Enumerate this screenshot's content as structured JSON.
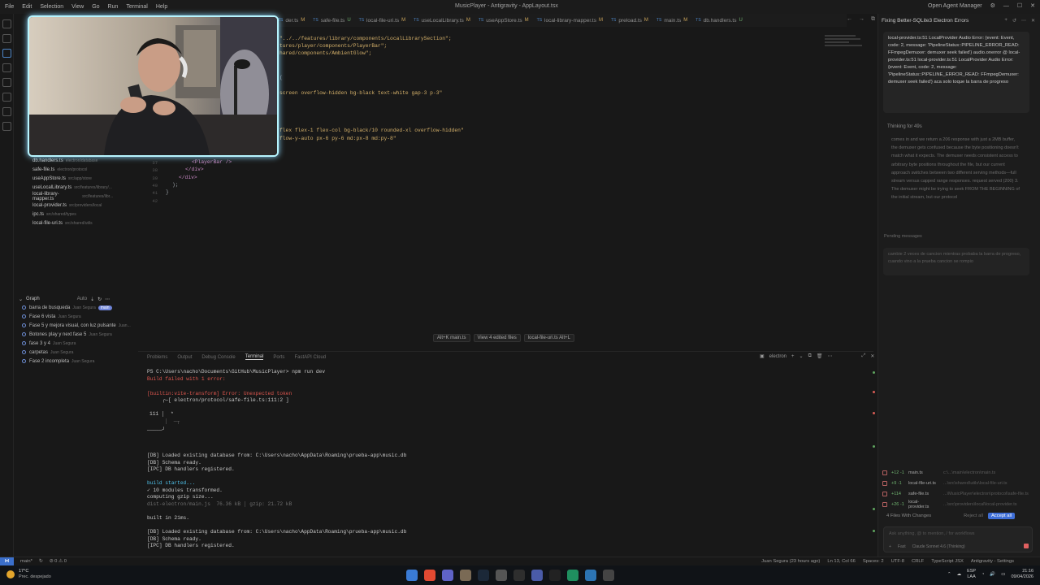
{
  "titlebar": {
    "menu": [
      "File",
      "Edit",
      "Selection",
      "View",
      "Go",
      "Run",
      "Terminal",
      "Help"
    ],
    "title": "MusicPlayer - Antigravity - AppLayout.tsx",
    "agent_manager": "Open Agent Manager"
  },
  "tabs": [
    {
      "label": "der.ts",
      "mark": "M",
      "icon": "ts"
    },
    {
      "label": "safe-file.ts",
      "mark": "U",
      "icon": "ts"
    },
    {
      "label": "local-file-uri.ts",
      "mark": "M",
      "icon": "ts"
    },
    {
      "label": "useLocalLibrary.ts",
      "mark": "M",
      "icon": "ts"
    },
    {
      "label": "useAppStore.ts",
      "mark": "M",
      "icon": "ts"
    },
    {
      "label": "local-library-mapper.ts",
      "mark": "M",
      "icon": "ts"
    },
    {
      "label": "preload.ts",
      "mark": "M",
      "icon": "ts"
    },
    {
      "label": "main.ts",
      "mark": "M",
      "icon": "ts"
    },
    {
      "label": "db.handlers.ts",
      "mark": "U",
      "icon": "ts"
    }
  ],
  "sidebar": {
    "files": [
      {
        "name": "db.handlers.ts",
        "path": "electron/database",
        "status": "U"
      },
      {
        "name": "safe-file.ts",
        "path": "electron/protocol",
        "status": "U"
      },
      {
        "name": "useAppStore.ts",
        "path": "src/app/store",
        "status": "M"
      },
      {
        "name": "useLocalLibrary.ts",
        "path": "src/features/library/...",
        "status": "M"
      },
      {
        "name": "local-library-mapper.ts",
        "path": "src/features/libr...",
        "status": "M"
      },
      {
        "name": "local-provider.ts",
        "path": "src/providers/local",
        "status": "M"
      },
      {
        "name": "ipc.ts",
        "path": "src/shared/types",
        "status": "U"
      },
      {
        "name": "local-file-uri.ts",
        "path": "src/shared/utils",
        "status": "M"
      }
    ],
    "graph": {
      "title": "Graph",
      "auto": "Auto",
      "commits": [
        {
          "message": "barra de busqueda",
          "author": "Juan Segura",
          "badge": "main"
        },
        {
          "message": "Fase 6 vista",
          "author": "Juan Segura"
        },
        {
          "message": "Fase 5 y mejora visual, con luz pulsante",
          "author": "Juan..."
        },
        {
          "message": "Botones play y next fase 5",
          "author": "Juan Segura"
        },
        {
          "message": "fase 3 y 4",
          "author": "Juan Segura"
        },
        {
          "message": "carpetas",
          "author": "Juan Segura"
        },
        {
          "message": "Fase 2 incompleta",
          "author": "Juan Segura"
        }
      ]
    }
  },
  "editor": {
    "lines": [
      {
        "text": "\"../../features/library/components/LocalLibrarySection\";",
        "kind": "s"
      },
      {
        "text": "tures/player/components/PlayerBar\";",
        "kind": "s"
      },
      {
        "text": "hared/components/AmbientGlow\";",
        "kind": "s"
      },
      {
        "text": "(",
        "kind": "g"
      },
      {
        "text": "screen overflow-hidden bg-black text-white gap-3 p-3\"",
        "kind": "s"
      },
      {
        "text": "flex flex-1 flex-col bg-black/10 rounded-xl overflow-hidden\"",
        "kind": "s"
      },
      {
        "text": "flow-y-auto px-6 py-6 md:px-8 md:py-8\"",
        "kind": "s"
      },
      {
        "text": "<PlayerBar />",
        "kind": "j"
      },
      {
        "text": "</div>",
        "kind": "j"
      },
      {
        "text": "</div>",
        "kind": "j"
      },
      {
        "text": ");",
        "kind": "g"
      },
      {
        "text": "}",
        "kind": "g"
      }
    ],
    "line_numbers": [
      "37",
      "38",
      "39",
      "40",
      "41",
      "42"
    ],
    "review_bar": {
      "prev": "Alt+K main.ts",
      "edited": "View 4 edited files",
      "next": "local-file-uri.ts Alt+L"
    }
  },
  "panel": {
    "tabs": [
      "Problems",
      "Output",
      "Debug Console",
      "Terminal",
      "Ports",
      "FastAPI Cloud"
    ],
    "active_tab": "Terminal",
    "shell": "electron",
    "terminal_lines": [
      {
        "text": "PS C:\\Users\\nacho\\Documents\\GitHub\\MusicPlayer> npm run dev",
        "kind": "n"
      },
      {
        "text": "Build failed with 1 error:",
        "kind": "err"
      },
      {
        "text": "[builtin:vite-transform] Error: Unexpected token",
        "kind": "err"
      },
      {
        "text": "     ╭─[ electron/protocol/safe-file.ts:111:2 ]",
        "kind": "n"
      },
      {
        "text": "111 │  *",
        "kind": "n"
      },
      {
        "text": "     │  ─┬",
        "kind": "dim"
      },
      {
        "text": "─────╯",
        "kind": "n"
      },
      {
        "text": "[DB] Loaded existing database from: C:\\Users\\nacho\\AppData\\Roaming\\prueba-app\\music.db",
        "kind": "n"
      },
      {
        "text": "[DB] Schema ready.",
        "kind": "n"
      },
      {
        "text": "[IPC] DB handlers registered.",
        "kind": "n"
      },
      {
        "text": "build started...",
        "kind": "cyan"
      },
      {
        "text": "✓ 10 modules transformed.",
        "kind": "n"
      },
      {
        "text": "computing gzip size...",
        "kind": "n"
      },
      {
        "text": "dist-electron/main.js  76.36 kB │ gzip: 21.72 kB",
        "kind": "dim"
      },
      {
        "text": "built in 21ms.",
        "kind": "n"
      },
      {
        "text": "[DB] Loaded existing database from: C:\\Users\\nacho\\AppData\\Roaming\\prueba-app\\music.db",
        "kind": "n"
      },
      {
        "text": "[DB] Schema ready.",
        "kind": "n"
      },
      {
        "text": "[IPC] DB handlers registered.",
        "kind": "n"
      }
    ]
  },
  "chat": {
    "title": "Fixing Better-SQLite3 Electron Errors",
    "user_message": "local-provider.ts:51 LocalProvider Audio Error: {event: Event, code: 2, message: 'PipelineStatus::PIPELINE_ERROR_READ: FFmpegDemuxer: demuxer seek failed'} audio.onerror @ local-provider.ts:51 local-provider.ts:51 LocalProvider Audio Error: {event: Event, code: 2, message: 'PipelineStatus::PIPELINE_ERROR_READ: FFmpegDemuxer: demuxer seek failed'} aca solo toque la barra de progreso",
    "thinking_label": "Thinking for 49s",
    "thinking_text": "comes in and we return a 206 response with just a 2MB buffer, the demuxer gets confused because the byte positioning doesn't match what it expects. The demuxer needs consistent access to arbitrary byte positions throughout the file, but our current approach switches between two different serving methods—full stream versus capped range responses. request served (200) 3. The demuxer might be trying to seek FROM THE BEGINNING of the initial stream, but our protocol",
    "pending_label": "Pending messages",
    "pending_text": "cambie 2 veces de cancion mientras probaba la barra de progreso, cuando vino a la prueba cancion se rompio",
    "changes": [
      {
        "count": "+12 -1",
        "file": "main.ts",
        "path": "c:\\...\\main\\electron\\main.ts"
      },
      {
        "count": "+9 -1",
        "file": "local-file-uri.ts",
        "path": "...\\src\\shared\\utils\\local-file-uri.ts"
      },
      {
        "count": "+114",
        "file": "safe-file.ts",
        "path": "...\\MusicPlayer\\electron\\protocol\\safe-file.ts"
      },
      {
        "count": "+26 -1",
        "file": "local-provider.ts",
        "path": "...\\src\\providers\\local\\local-provider.ts"
      }
    ],
    "changes_summary": "4 Files With Changes",
    "reject_all": "Reject all",
    "accept_all": "Accept all",
    "input_placeholder": "Ask anything, @ to mention, / for workflows",
    "mode": "Fast",
    "model": "Claude Sonnet 4.6 (Thinking)"
  },
  "statusbar": {
    "branch": "main*",
    "problems": "⊘ 0 ⚠ 0",
    "author": "Juan Segura (23 hours ago)",
    "position": "Ln 13, Col 66",
    "spaces": "Spaces: 2",
    "encoding": "UTF-8",
    "eol": "CRLF",
    "language": "TypeScript JSX",
    "settings": "Antigravity - Settings"
  },
  "taskbar": {
    "temp": "17°C",
    "weather": "Prec. despejado",
    "lang_top": "ESP",
    "lang_bottom": "LAA",
    "time": "21:16",
    "date": "09/04/2026"
  },
  "colors": {
    "accent": "#3f6fd8",
    "error": "#e0574f",
    "webcam_border": "#b7f5ff"
  }
}
